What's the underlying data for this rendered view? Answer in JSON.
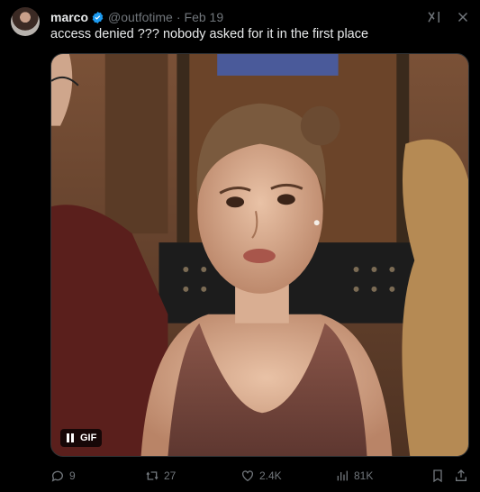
{
  "tweet": {
    "author_name": "marco",
    "handle": "@outfotime",
    "separator": "·",
    "date": "Feb 19",
    "text": "access denied ??? nobody asked for it in the first place"
  },
  "media": {
    "gif_label": "GIF",
    "icons": [
      "pause-icon"
    ]
  },
  "actions": {
    "replies": "9",
    "reposts": "27",
    "likes": "2.4K",
    "views": "81K"
  },
  "colors": {
    "background": "#000000",
    "text": "#e7e9ea",
    "muted": "#71767b",
    "verified": "#1d9bf0"
  }
}
